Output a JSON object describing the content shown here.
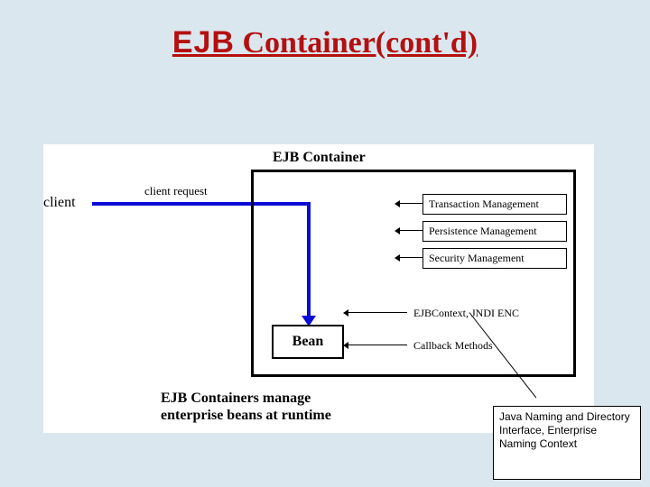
{
  "title": {
    "ejb": "EJB",
    "rest": " Container(cont'd)"
  },
  "diagram": {
    "client_label": "client",
    "client_request_label": "client request",
    "container_title": "EJB Container",
    "services": {
      "tx": "Transaction Management",
      "pm": "Persistence Management",
      "sec": "Security Management"
    },
    "bean_label": "Bean",
    "jndi_label": "EJBContext, JNDI ENC",
    "callback_label": "Callback Methods",
    "caption_line1": "EJB Containers manage",
    "caption_line2": "enterprise beans at runtime"
  },
  "callout": {
    "text": "Java Naming and Directory Interface, Enterprise Naming Context"
  }
}
